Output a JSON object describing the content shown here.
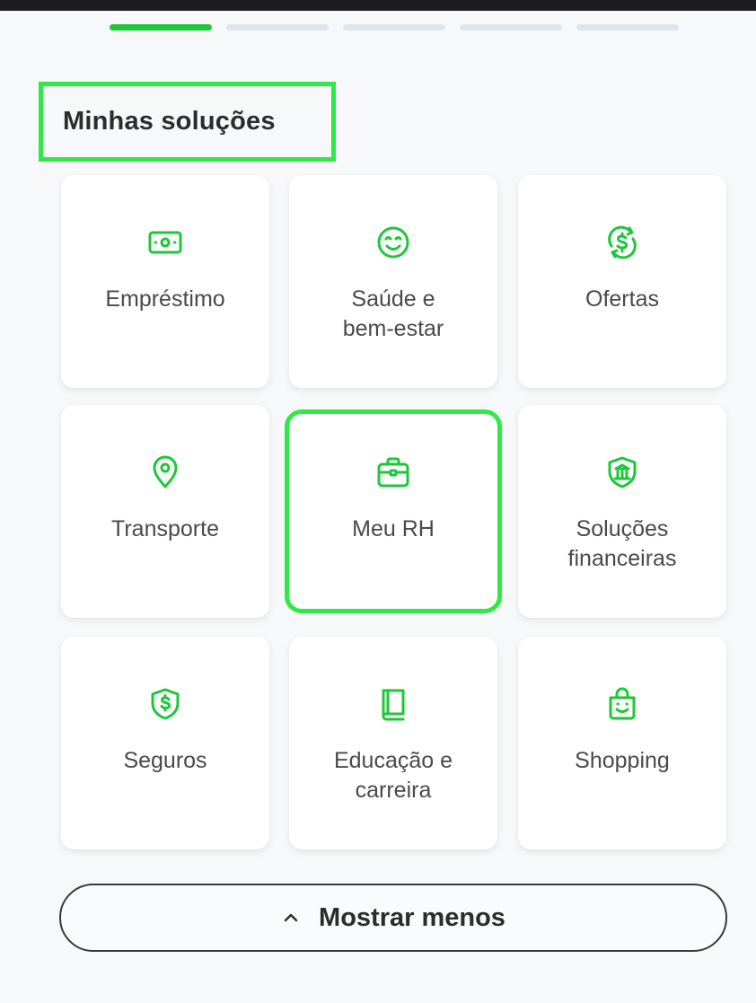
{
  "section": {
    "title": "Minhas soluções"
  },
  "progress": {
    "segments": 5,
    "active_index": 0
  },
  "accent_color": "#1ec73a",
  "highlight_color": "#2ee946",
  "cards": [
    {
      "label": "Empréstimo",
      "icon": "money-icon"
    },
    {
      "label": "Saúde e\nbem-estar",
      "icon": "smile-icon"
    },
    {
      "label": "Ofertas",
      "icon": "dollar-refresh-icon"
    },
    {
      "label": "Transporte",
      "icon": "map-pin-icon"
    },
    {
      "label": "Meu RH",
      "icon": "briefcase-icon"
    },
    {
      "label": "Soluções\nfinanceiras",
      "icon": "bank-icon"
    },
    {
      "label": "Seguros",
      "icon": "shield-dollar-icon"
    },
    {
      "label": "Educação e\ncarreira",
      "icon": "book-icon"
    },
    {
      "label": "Shopping",
      "icon": "shopping-bag-icon"
    }
  ],
  "toggle": {
    "label": "Mostrar menos",
    "icon": "chevron-up-icon"
  }
}
